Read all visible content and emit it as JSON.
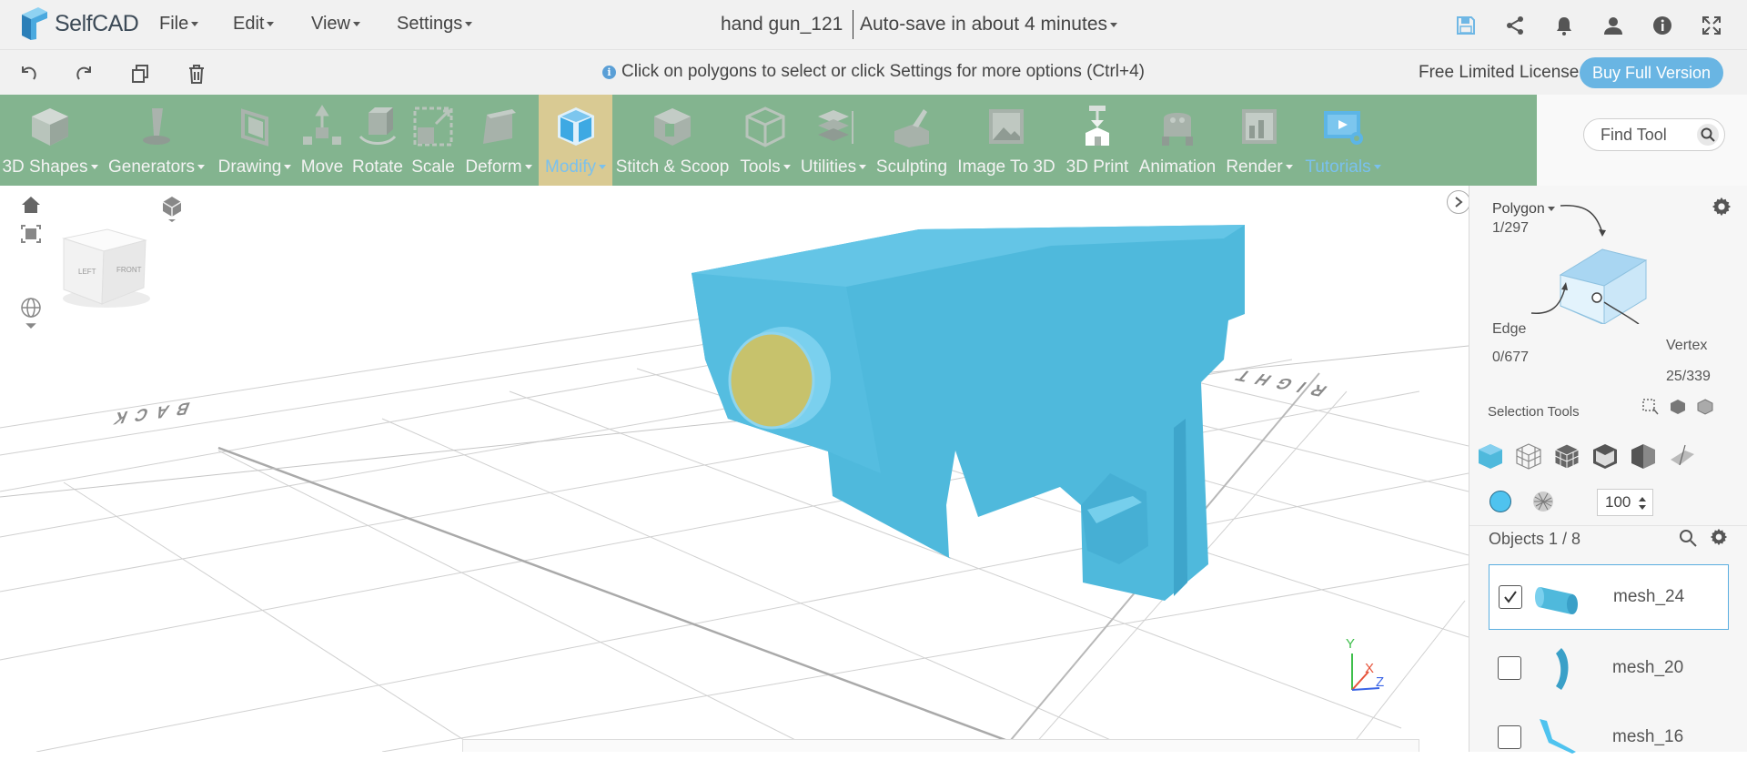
{
  "app": {
    "name": "SelfCAD"
  },
  "menu": {
    "file": "File",
    "edit": "Edit",
    "view": "View",
    "settings": "Settings"
  },
  "project": {
    "title": "hand gun_121",
    "autosave": "Auto-save in about 4 minutes"
  },
  "header_icons": [
    "save-icon",
    "share-icon",
    "bell-icon",
    "user-icon",
    "info-icon",
    "fullscreen-icon"
  ],
  "hint": {
    "text": "Click on polygons to select or click Settings for more options (Ctrl+4)"
  },
  "license": {
    "text": "Free Limited License",
    "buy_label": "Buy Full Version"
  },
  "toolbar": {
    "tools": [
      {
        "label": "3D Shapes",
        "dropdown": true
      },
      {
        "label": "Generators",
        "dropdown": true
      },
      {
        "label": "Drawing",
        "dropdown": true
      },
      {
        "label": "Move",
        "dropdown": false
      },
      {
        "label": "Rotate",
        "dropdown": false
      },
      {
        "label": "Scale",
        "dropdown": false
      },
      {
        "label": "Deform",
        "dropdown": true
      },
      {
        "label": "Modify",
        "dropdown": true,
        "active": true
      },
      {
        "label": "Stitch & Scoop",
        "dropdown": false
      },
      {
        "label": "Tools",
        "dropdown": true
      },
      {
        "label": "Utilities",
        "dropdown": true
      },
      {
        "label": "Sculpting",
        "dropdown": false
      },
      {
        "label": "Image To 3D",
        "dropdown": false
      },
      {
        "label": "3D Print",
        "dropdown": false
      },
      {
        "label": "Animation",
        "dropdown": false
      },
      {
        "label": "Render",
        "dropdown": true
      },
      {
        "label": "Tutorials",
        "dropdown": true
      }
    ]
  },
  "find_tool": {
    "placeholder": "Find Tool"
  },
  "viewport": {
    "view_cube": {
      "left": "LEFT",
      "front": "FRONT"
    },
    "floor_labels": {
      "back": "BACK",
      "right": "RIGHT"
    },
    "axes": {
      "x": "X",
      "y": "Y",
      "z": "Z"
    }
  },
  "selection": {
    "polygon_label": "Polygon",
    "polygon_count": "1/297",
    "edge_label": "Edge",
    "edge_count": "0/677",
    "vertex_label": "Vertex",
    "vertex_count": "25/339",
    "tools_title": "Selection Tools",
    "opacity_value": "100"
  },
  "objects": {
    "title": "Objects 1 / 8",
    "items": [
      {
        "name": "mesh_24",
        "checked": true
      },
      {
        "name": "mesh_20",
        "checked": false
      },
      {
        "name": "mesh_16",
        "checked": false
      }
    ]
  },
  "colors": {
    "toolbar_bg": "#83b48f",
    "active_tool_bg": "#d9ca93",
    "accent": "#69b5e3",
    "model": "#4fb9dc"
  }
}
